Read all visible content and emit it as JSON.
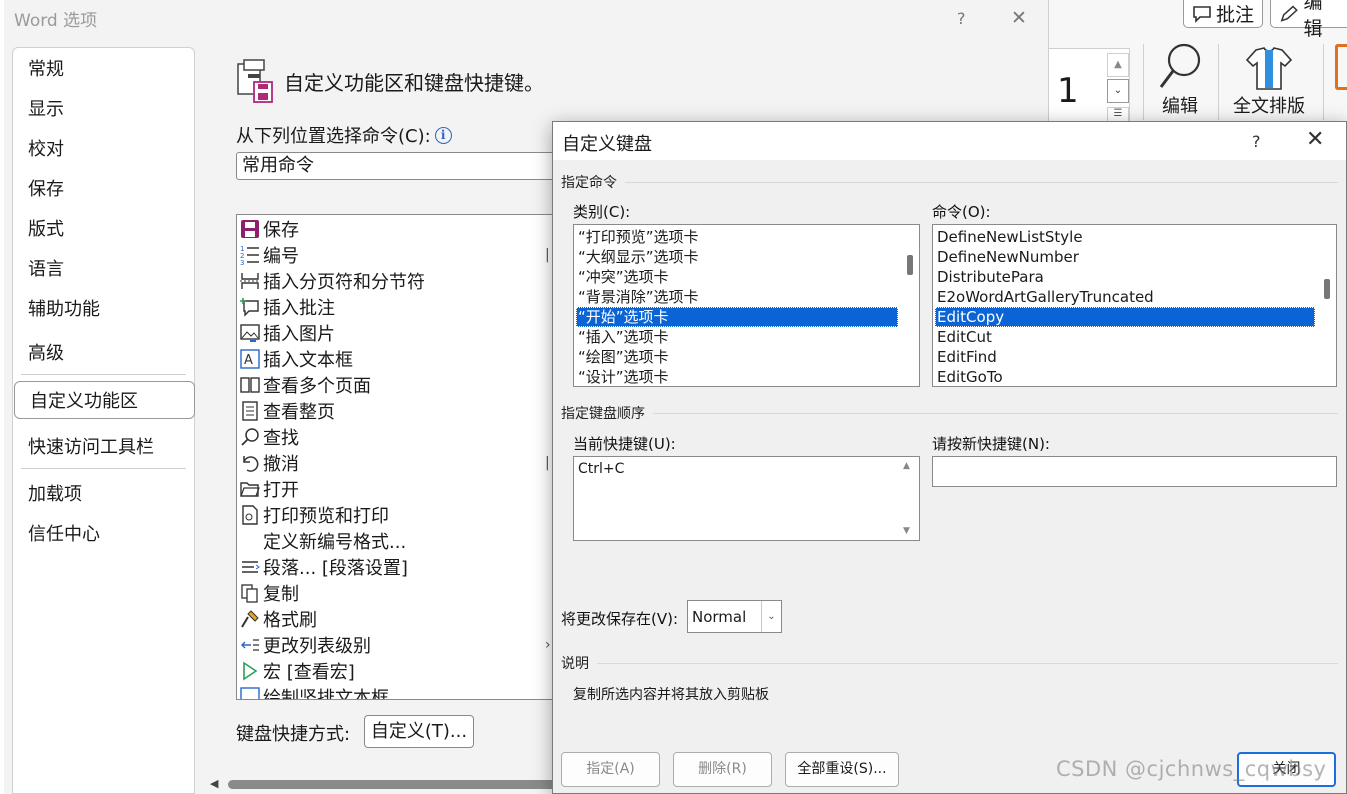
{
  "background": {
    "top_buttons": [
      "批注",
      "编辑"
    ],
    "ribbon_number": "1",
    "ribbon_buttons": [
      "编辑",
      "全文排版"
    ]
  },
  "options_dialog": {
    "title": "Word 选项",
    "help": "?",
    "close": "✕",
    "nav": [
      {
        "label": "常规"
      },
      {
        "label": "显示"
      },
      {
        "label": "校对"
      },
      {
        "label": "保存"
      },
      {
        "label": "版式"
      },
      {
        "label": "语言"
      },
      {
        "label": "辅助功能"
      },
      {
        "label": "高级"
      },
      {
        "label": "自定义功能区"
      },
      {
        "label": "快速访问工具栏"
      },
      {
        "label": "加载项"
      },
      {
        "label": "信任中心"
      }
    ],
    "heading": "自定义功能区和键盘快捷键。",
    "choose_label": "从下列位置选择命令(C):",
    "choose_value": "常用命令",
    "commands": [
      {
        "label": "保存",
        "icon": "save-icon"
      },
      {
        "label": "编号",
        "icon": "numbering-icon"
      },
      {
        "label": "插入分页符和分节符",
        "icon": "page-break-icon"
      },
      {
        "label": "插入批注",
        "icon": "comment-icon"
      },
      {
        "label": "插入图片",
        "icon": "picture-icon"
      },
      {
        "label": "插入文本框",
        "icon": "textbox-icon"
      },
      {
        "label": "查看多个页面",
        "icon": "multipage-icon"
      },
      {
        "label": "查看整页",
        "icon": "page-icon"
      },
      {
        "label": "查找",
        "icon": "find-icon"
      },
      {
        "label": "撤消",
        "icon": "undo-icon"
      },
      {
        "label": "打开",
        "icon": "open-folder-icon"
      },
      {
        "label": "打印预览和打印",
        "icon": "print-preview-icon"
      },
      {
        "label": "定义新编号格式...",
        "icon": ""
      },
      {
        "label": "段落... [段落设置]",
        "icon": "paragraph-icon"
      },
      {
        "label": "复制",
        "icon": "copy-icon"
      },
      {
        "label": "格式刷",
        "icon": "format-painter-icon"
      },
      {
        "label": "更改列表级别",
        "icon": "list-level-icon"
      },
      {
        "label": "宏 [查看宏]",
        "icon": "macro-icon"
      },
      {
        "label": "绘制竖排文本框",
        "icon": "vertical-textbox-icon"
      }
    ],
    "keyboard_label": "键盘快捷方式:",
    "keyboard_button": "自定义(T)..."
  },
  "keyboard_dialog": {
    "title": "自定义键盘",
    "help": "?",
    "close": "✕",
    "section_command": "指定命令",
    "categories_label": "类别(C):",
    "categories": [
      "“打印预览”选项卡",
      "“大纲显示”选项卡",
      "“冲突”选项卡",
      "“背景消除”选项卡",
      "“开始”选项卡",
      "“插入”选项卡",
      "“绘图”选项卡",
      "“设计”选项卡"
    ],
    "categories_selected": 4,
    "commands_label": "命令(O):",
    "commands": [
      "DefineNewListStyle",
      "DefineNewNumber",
      "DistributePara",
      "E2oWordArtGalleryTruncated",
      "EditCopy",
      "EditCut",
      "EditFind",
      "EditGoTo"
    ],
    "commands_selected": 4,
    "section_keys": "指定键盘顺序",
    "current_keys_label": "当前快捷键(U):",
    "current_keys": [
      "Ctrl+C"
    ],
    "new_key_label": "请按新快捷键(N):",
    "new_key_value": "",
    "save_in_label": "将更改保存在(V):",
    "save_in_value": "Normal",
    "section_desc": "说明",
    "description": "复制所选内容并将其放入剪贴板",
    "buttons": {
      "assign": "指定(A)",
      "remove": "删除(R)",
      "reset_all": "全部重设(S)...",
      "close": "关闭"
    }
  },
  "watermark": "CSDN @cjchnws_cqwbsy"
}
